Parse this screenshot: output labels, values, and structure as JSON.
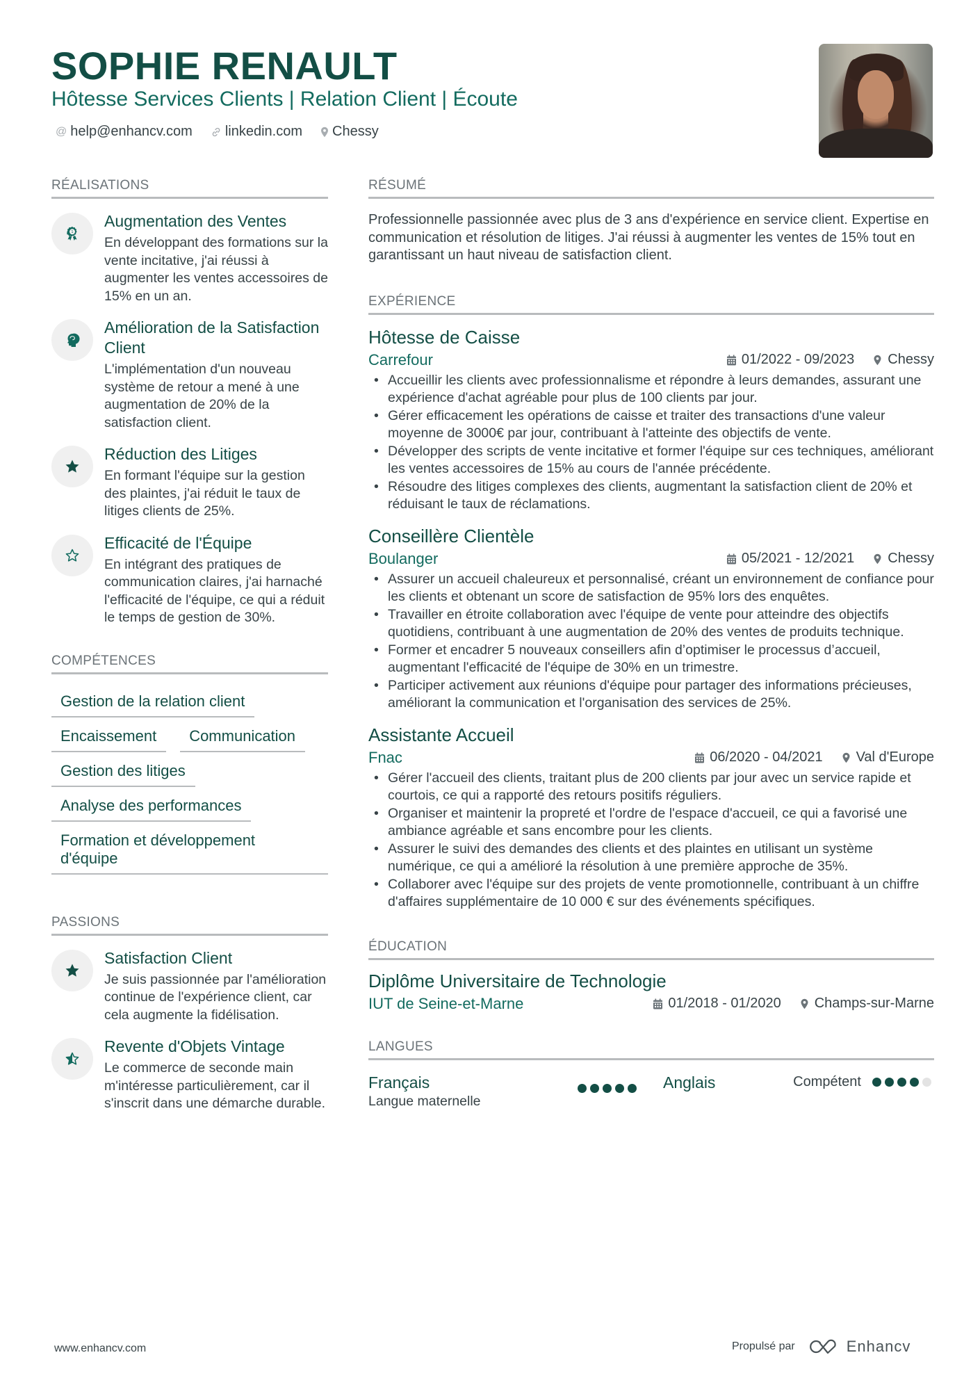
{
  "header": {
    "name": "SOPHIE RENAULT",
    "headline": "Hôtesse Services Clients | Relation Client | Écoute",
    "contacts": [
      {
        "icon": "at-icon",
        "text": "help@enhancv.com"
      },
      {
        "icon": "link-icon",
        "text": "linkedin.com"
      },
      {
        "icon": "location-icon",
        "text": "Chessy"
      }
    ],
    "photo_alt": "Photo de profil"
  },
  "left": {
    "achievements": {
      "title": "RÉALISATIONS",
      "items": [
        {
          "icon": "award-ribbon-icon",
          "title": "Augmentation des Ventes",
          "desc": "En développant des formations sur la vente incitative, j'ai réussi à augmenter les ventes accessoires de 15% en un an."
        },
        {
          "icon": "head-brain-icon",
          "title": "Amélioration de la Satisfaction Client",
          "desc": "L'implémentation d'un nouveau système de retour a mené à une augmentation de 20% de la satisfaction client."
        },
        {
          "icon": "star-filled-icon",
          "title": "Réduction des Litiges",
          "desc": "En formant l'équipe sur la gestion des plaintes, j'ai réduit le taux de litiges clients de 25%."
        },
        {
          "icon": "star-outline-icon",
          "title": "Efficacité de l'Équipe",
          "desc": "En intégrant des pratiques de communication claires, j'ai harnaché l'efficacité de l'équipe, ce qui a réduit le temps de gestion de 30%."
        }
      ]
    },
    "skills": {
      "title": "COMPÉTENCES",
      "items": [
        "Gestion de la relation client",
        "Encaissement",
        "Communication",
        "Gestion des litiges",
        "Analyse des performances",
        "Formation et développement d'équipe"
      ]
    },
    "passions": {
      "title": "PASSIONS",
      "items": [
        {
          "icon": "star-filled-icon",
          "title": "Satisfaction Client",
          "desc": "Je suis passionnée par l'amélioration continue de l'expérience client, car cela augmente la fidélisation."
        },
        {
          "icon": "star-half-icon",
          "title": "Revente d'Objets Vintage",
          "desc": "Le commerce de seconde main m'intéresse particulièrement, car il s'inscrit dans une démarche durable."
        }
      ]
    }
  },
  "right": {
    "summary": {
      "title": "RÉSUMÉ",
      "text": "Professionnelle passionnée avec plus de 3 ans d'expérience en service client. Expertise en communication et résolution de litiges. J'ai réussi à augmenter les ventes de 15% tout en garantissant un haut niveau de satisfaction client."
    },
    "experience": {
      "title": "EXPÉRIENCE",
      "jobs": [
        {
          "title": "Hôtesse de Caisse",
          "company": "Carrefour",
          "dates": "01/2022 - 09/2023",
          "location": "Chessy",
          "bullets": [
            "Accueillir les clients avec professionnalisme et répondre à leurs demandes, assurant une expérience d'achat agréable pour plus de 100 clients par jour.",
            "Gérer efficacement les opérations de caisse et traiter des transactions d'une valeur moyenne de 3000€ par jour, contribuant à l'atteinte des objectifs de vente.",
            "Développer des scripts de vente incitative et former l'équipe sur ces techniques, améliorant les ventes accessoires de 15% au cours de l'année précédente.",
            "Résoudre des litiges complexes des clients, augmentant la satisfaction client de 20% et réduisant le taux de réclamations."
          ]
        },
        {
          "title": "Conseillère Clientèle",
          "company": "Boulanger",
          "dates": "05/2021 - 12/2021",
          "location": "Chessy",
          "bullets": [
            "Assurer un accueil chaleureux et personnalisé, créant un environnement de confiance pour les clients et obtenant un score de satisfaction de 95% lors des enquêtes.",
            "Travailler en étroite collaboration avec l'équipe de vente pour atteindre des objectifs quotidiens, contribuant à une augmentation de 20% des ventes de produits technique.",
            "Former et encadrer 5 nouveaux conseillers afin d’optimiser le processus d’accueil, augmentant l'efficacité de l'équipe de 30% en un trimestre.",
            "Participer activement aux réunions d'équipe pour partager des informations précieuses, améliorant la communication et l'organisation des services de 25%."
          ]
        },
        {
          "title": "Assistante Accueil",
          "company": "Fnac",
          "dates": "06/2020 - 04/2021",
          "location": "Val d'Europe",
          "bullets": [
            "Gérer l'accueil des clients, traitant plus de 200 clients par jour avec un service rapide et courtois, ce qui a rapporté des retours positifs réguliers.",
            "Organiser et maintenir la propreté et l'ordre de l'espace d'accueil, ce qui a favorisé une ambiance agréable et sans encombre pour les clients.",
            "Assurer le suivi des demandes des clients et des plaintes en utilisant un système numérique, ce qui a amélioré la résolution à une première approche de 35%.",
            "Collaborer avec l'équipe sur des projets de vente promotionnelle, contribuant à un chiffre d'affaires supplémentaire de 10 000 € sur des événements spécifiques."
          ]
        }
      ]
    },
    "education": {
      "title": "ÉDUCATION",
      "items": [
        {
          "degree": "Diplôme Universitaire de Technologie",
          "school": "IUT de Seine-et-Marne",
          "dates": "01/2018 - 01/2020",
          "location": "Champs-sur-Marne"
        }
      ]
    },
    "languages": {
      "title": "LANGUES",
      "items": [
        {
          "name": "Français",
          "sub": "Langue maternelle",
          "level_label": "",
          "level": 5,
          "max": 5
        },
        {
          "name": "Anglais",
          "sub": "",
          "level_label": "Compétent",
          "level": 4,
          "max": 5
        }
      ]
    }
  },
  "footer": {
    "website": "www.enhancv.com",
    "powered_by": "Propulsé par",
    "brand": "Enhancv"
  },
  "colors": {
    "primary": "#134e45",
    "accent": "#136b5f",
    "text": "#384347",
    "rule": "#b8bbbd",
    "icon_bg": "#f0f0f0"
  }
}
